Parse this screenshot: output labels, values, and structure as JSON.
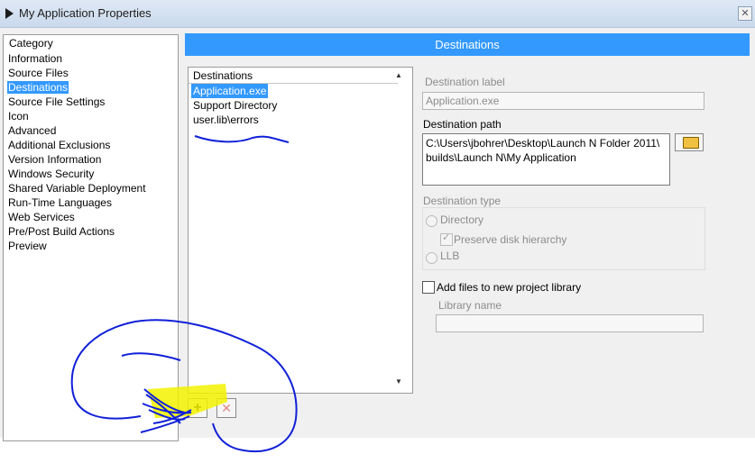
{
  "window": {
    "title": "My Application Properties",
    "close_glyph": "✕"
  },
  "category": {
    "header": "Category",
    "items": [
      {
        "label": "Information"
      },
      {
        "label": "Source Files"
      },
      {
        "label": "Destinations",
        "selected": true
      },
      {
        "label": "Source File Settings"
      },
      {
        "label": "Icon"
      },
      {
        "label": "Advanced"
      },
      {
        "label": "Additional Exclusions"
      },
      {
        "label": "Version Information"
      },
      {
        "label": "Windows Security"
      },
      {
        "label": "Shared Variable Deployment"
      },
      {
        "label": "Run-Time Languages"
      },
      {
        "label": "Web Services"
      },
      {
        "label": "Pre/Post Build Actions"
      },
      {
        "label": "Preview"
      }
    ]
  },
  "page_title": "Destinations",
  "destinations_list": {
    "header": "Destinations",
    "items": [
      {
        "label": "Application.exe",
        "selected": true
      },
      {
        "label": "Support Directory"
      },
      {
        "label": "user.lib\\errors"
      }
    ],
    "add_glyph": "+",
    "remove_glyph": "✕"
  },
  "form": {
    "destination_label": {
      "label": "Destination label",
      "value": "Application.exe"
    },
    "destination_path": {
      "label": "Destination path",
      "line1": "C:\\Users\\jbohrer\\Desktop\\Launch N Folder 2011\\",
      "line2": "builds\\Launch N\\My Application"
    },
    "destination_type": {
      "label": "Destination type",
      "options": {
        "directory": "Directory",
        "preserve": "Preserve disk hierarchy",
        "llb": "LLB"
      }
    },
    "add_files": {
      "label": "Add files to new project library",
      "checked": false
    },
    "library_name": {
      "label": "Library name",
      "value": ""
    }
  },
  "icons": {
    "app": "labview-icon",
    "browse": "folder-open-icon"
  },
  "colors": {
    "accent": "#3399ff",
    "annotation_blue": "#1020d8",
    "annotation_yellow": "#f2f200"
  }
}
